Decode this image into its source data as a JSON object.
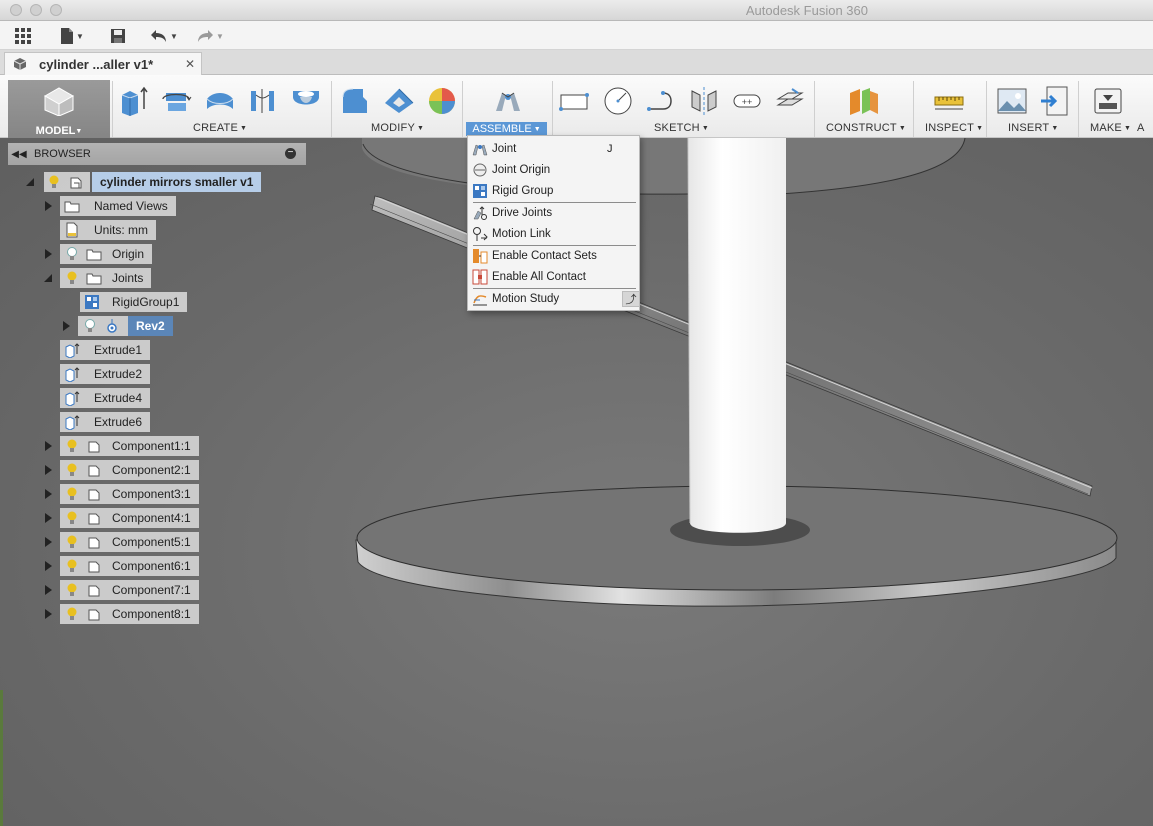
{
  "app": {
    "title": "Autodesk Fusion 360"
  },
  "document": {
    "tab_title": "cylinder ...aller v1*"
  },
  "ribbon": {
    "workspace": "MODEL",
    "groups": {
      "create": "CREATE",
      "modify": "MODIFY",
      "assemble": "ASSEMBLE",
      "sketch": "SKETCH",
      "construct": "CONSTRUCT",
      "inspect": "INSPECT",
      "insert": "INSERT",
      "make": "MAKE",
      "more": "A"
    }
  },
  "browser": {
    "title": "BROWSER",
    "root": "cylinder mirrors smaller v1",
    "named_views": "Named Views",
    "units": "Units: mm",
    "origin": "Origin",
    "joints": "Joints",
    "rigid_group": "RigidGroup1",
    "rev": "Rev2",
    "extrudes": [
      "Extrude1",
      "Extrude2",
      "Extrude4",
      "Extrude6"
    ],
    "components": [
      "Component1:1",
      "Component2:1",
      "Component3:1",
      "Component4:1",
      "Component5:1",
      "Component6:1",
      "Component7:1",
      "Component8:1"
    ]
  },
  "assemble_menu": {
    "items": [
      {
        "label": "Joint",
        "shortcut": "J"
      },
      {
        "label": "Joint Origin"
      },
      {
        "label": "Rigid Group"
      },
      {
        "label": "Drive Joints"
      },
      {
        "label": "Motion Link"
      },
      {
        "label": "Enable Contact Sets"
      },
      {
        "label": "Enable All Contact"
      },
      {
        "label": "Motion Study"
      }
    ]
  },
  "colors": {
    "accent": "#5b97d6",
    "selection": "#b6cde8",
    "rev_selection": "#5b86b8",
    "bulb": "#e8c020"
  }
}
